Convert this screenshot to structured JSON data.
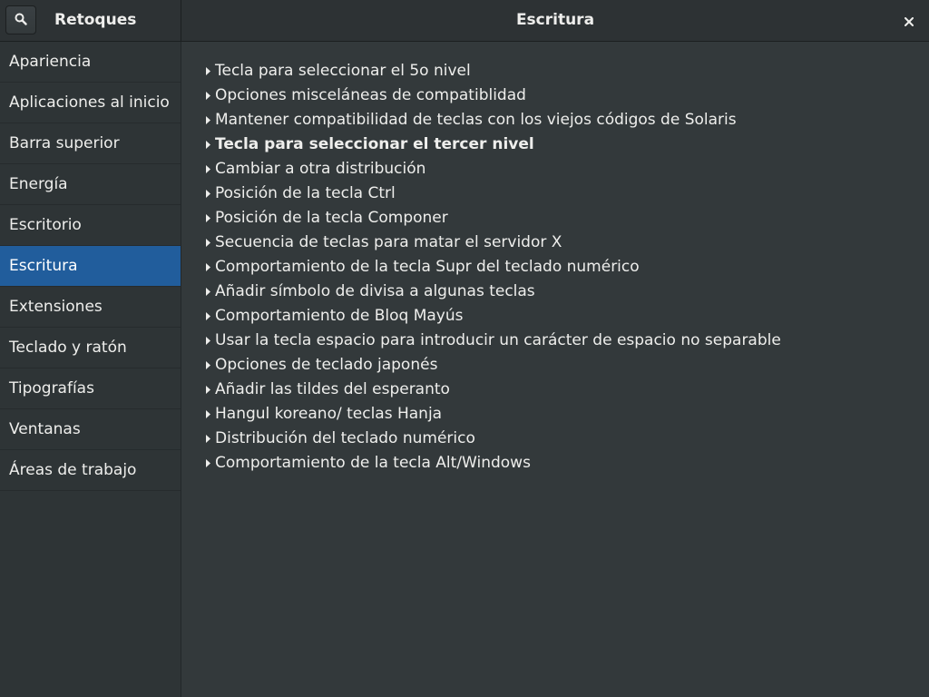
{
  "header": {
    "app_title": "Retoques",
    "page_title": "Escritura",
    "search_icon": "search-icon",
    "close_icon": "close-icon"
  },
  "sidebar": {
    "selected": "Escritura",
    "items": [
      {
        "label": "Apariencia"
      },
      {
        "label": "Aplicaciones al inicio"
      },
      {
        "label": "Barra superior"
      },
      {
        "label": "Energía"
      },
      {
        "label": "Escritorio"
      },
      {
        "label": "Escritura"
      },
      {
        "label": "Extensiones"
      },
      {
        "label": "Teclado y ratón"
      },
      {
        "label": "Tipografías"
      },
      {
        "label": "Ventanas"
      },
      {
        "label": "Áreas de trabajo"
      }
    ]
  },
  "options": [
    {
      "label": "Tecla para seleccionar el 5o nivel",
      "bold": false
    },
    {
      "label": "Opciones misceláneas de compatiblidad",
      "bold": false
    },
    {
      "label": "Mantener compatibilidad de teclas con los viejos códigos de Solaris",
      "bold": false
    },
    {
      "label": "Tecla para seleccionar el tercer nivel",
      "bold": true
    },
    {
      "label": "Cambiar a otra distribución",
      "bold": false
    },
    {
      "label": "Posición de la tecla Ctrl",
      "bold": false
    },
    {
      "label": "Posición de la tecla Componer",
      "bold": false
    },
    {
      "label": "Secuencia de teclas para matar el servidor X",
      "bold": false
    },
    {
      "label": "Comportamiento de la tecla Supr del teclado numérico",
      "bold": false
    },
    {
      "label": "Añadir símbolo de divisa a algunas teclas",
      "bold": false
    },
    {
      "label": "Comportamiento de Bloq Mayús",
      "bold": false
    },
    {
      "label": "Usar la tecla espacio para introducir un carácter de espacio no separable",
      "bold": false
    },
    {
      "label": "Opciones de teclado japonés",
      "bold": false
    },
    {
      "label": "Añadir las tildes del esperanto",
      "bold": false
    },
    {
      "label": "Hangul koreano/ teclas Hanja",
      "bold": false
    },
    {
      "label": "Distribución del teclado numérico",
      "bold": false
    },
    {
      "label": "Comportamiento de la tecla Alt/Windows",
      "bold": false
    }
  ],
  "colors": {
    "selection": "#215d9c",
    "background": "#33393b",
    "sidebar_background": "#2e3436",
    "text": "#eeeeec"
  }
}
